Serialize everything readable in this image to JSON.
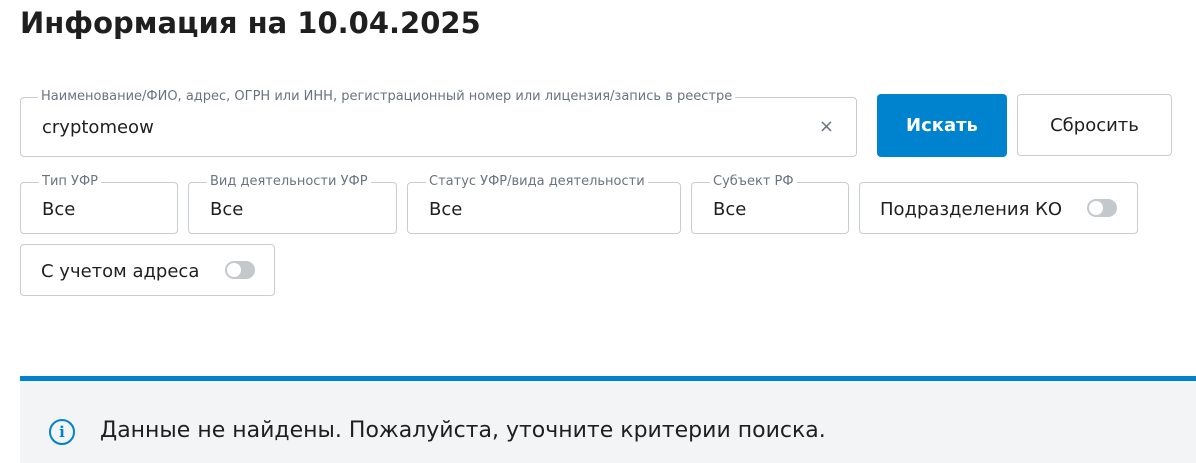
{
  "page": {
    "title": "Информация на 10.04.2025"
  },
  "search": {
    "label": "Наименование/ФИО, адрес, ОГРН или ИНН, регистрационный номер или лицензия/запись в реестре",
    "value": "cryptomeow",
    "clear_glyph": "×",
    "search_button": "Искать",
    "reset_button": "Сбросить"
  },
  "filters": {
    "type": {
      "label": "Тип УФР",
      "value": "Все"
    },
    "activity": {
      "label": "Вид деятельности УФР",
      "value": "Все"
    },
    "status": {
      "label": "Статус УФР/вида деятельности",
      "value": "Все"
    },
    "subject": {
      "label": "Субъект РФ",
      "value": "Все"
    }
  },
  "toggles": {
    "ko_divisions": {
      "label": "Подразделения КО",
      "on": false
    },
    "with_address": {
      "label": "С учетом адреса",
      "on": false
    }
  },
  "notice": {
    "icon": "info-icon",
    "icon_glyph": "i",
    "text": "Данные не найдены. Пожалуйста, уточните критерии поиска."
  },
  "colors": {
    "accent": "#0083cf",
    "border": "#c8cdd3",
    "notice_bg": "#f3f4f5",
    "switch_off": "#c4c8cd"
  }
}
